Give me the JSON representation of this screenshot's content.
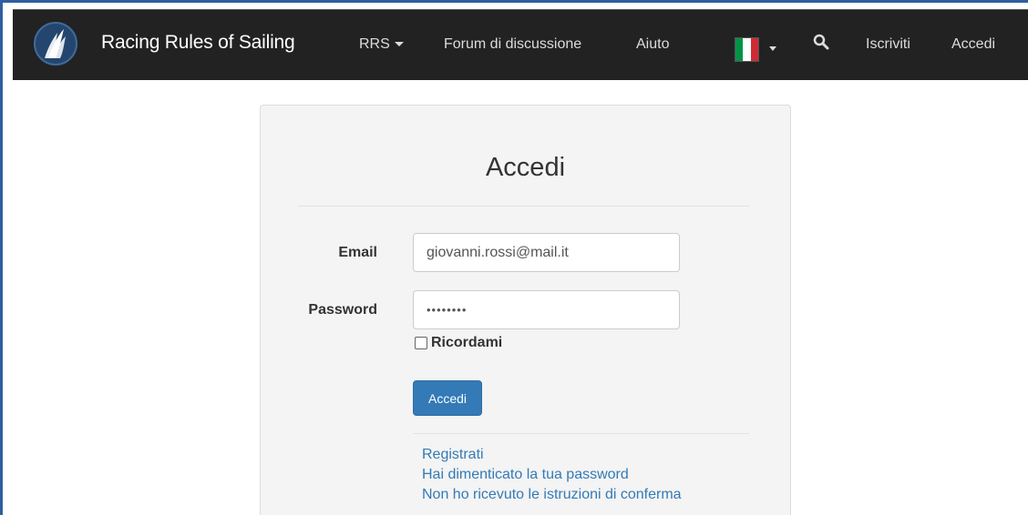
{
  "header": {
    "brand": "Racing Rules of Sailing",
    "nav": {
      "rrs": "RRS",
      "forum": "Forum di discussione",
      "help": "Aiuto",
      "register": "Iscriviti",
      "login": "Accedi"
    },
    "language_flag": "italy-flag-icon",
    "search_icon": "search-icon"
  },
  "login": {
    "title": "Accedi",
    "email_label": "Email",
    "email_value": "giovanni.rossi@mail.it",
    "password_label": "Password",
    "password_value": "••••••••",
    "remember_label": "Ricordami",
    "submit_label": "Accedi"
  },
  "links": {
    "register": "Registrati",
    "forgot_password": "Hai dimenticato la tua password",
    "no_confirmation": "Non ho ricevuto le istruzioni di conferma"
  },
  "colors": {
    "navbar": "#222222",
    "primary": "#337ab7",
    "flag_green": "#009246",
    "flag_white": "#ffffff",
    "flag_red": "#ce2b37"
  }
}
